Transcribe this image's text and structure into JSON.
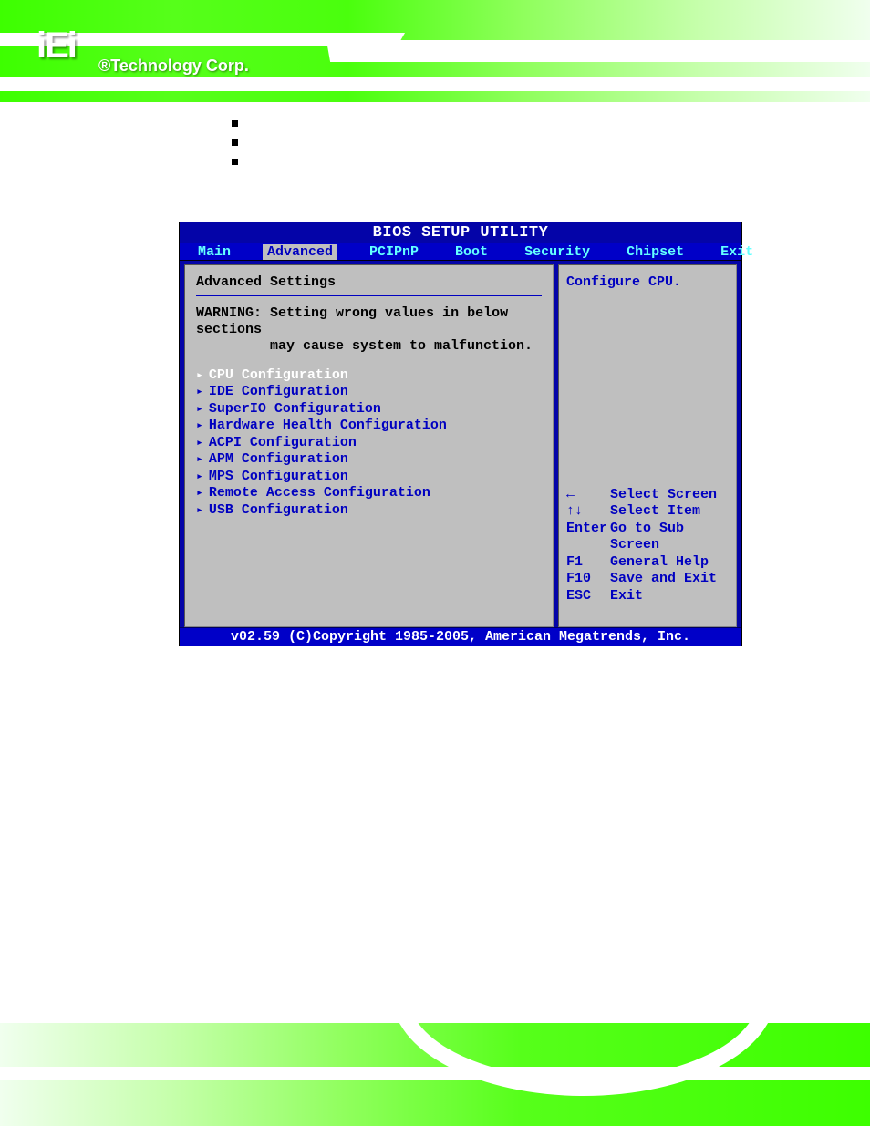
{
  "logo": {
    "name": "iEi",
    "tagline": "®Technology Corp."
  },
  "bullets": [
    "",
    "",
    ""
  ],
  "bios": {
    "title": "BIOS SETUP UTILITY",
    "tabs": [
      "Main",
      "Advanced",
      "PCIPnP",
      "Boot",
      "Security",
      "Chipset",
      "Exit"
    ],
    "active_tab": 1,
    "panel_title": "Advanced Settings",
    "warning_label": "WARNING:",
    "warning_text_l1": "Setting wrong values in below sections",
    "warning_text_l2": "may cause system to malfunction.",
    "menu_items": [
      "CPU Configuration",
      "IDE Configuration",
      "SuperIO Configuration",
      "Hardware Health Configuration",
      "ACPI Configuration",
      "APM Configuration",
      "MPS Configuration",
      "Remote Access Configuration",
      "USB Configuration"
    ],
    "selected_index": 0,
    "help_text": "Configure CPU.",
    "keys": [
      {
        "key": "←",
        "action": "Select Screen"
      },
      {
        "key": "↑↓",
        "action": "Select Item"
      },
      {
        "key": "Enter",
        "action": "Go to Sub Screen"
      },
      {
        "key": "F1",
        "action": "General Help"
      },
      {
        "key": "F10",
        "action": "Save and Exit"
      },
      {
        "key": "ESC",
        "action": "Exit"
      }
    ],
    "copyright": "v02.59 (C)Copyright 1985-2005, American Megatrends, Inc."
  }
}
